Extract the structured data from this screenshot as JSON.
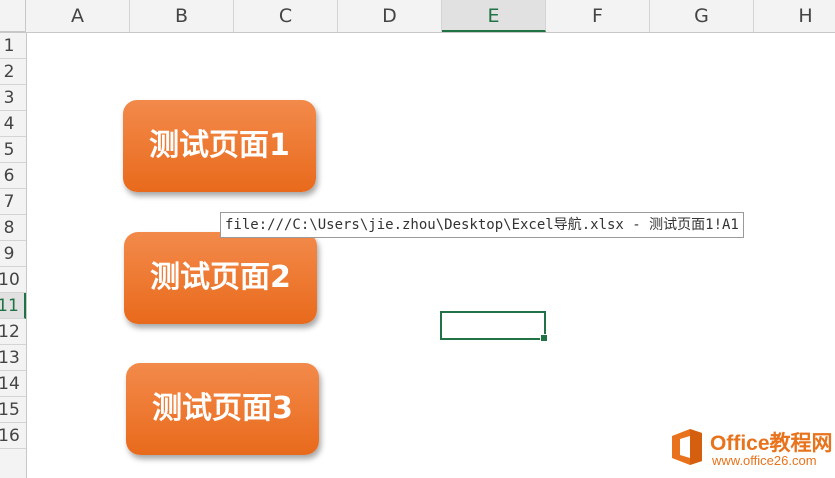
{
  "columns": [
    "A",
    "B",
    "C",
    "D",
    "E",
    "F",
    "G",
    "H"
  ],
  "active_column": "E",
  "rows": [
    "1",
    "2",
    "3",
    "4",
    "5",
    "6",
    "7",
    "8",
    "9",
    "10",
    "11",
    "12",
    "13",
    "14",
    "15",
    "16"
  ],
  "active_row": "11",
  "buttons": [
    {
      "label": "测试页面1"
    },
    {
      "label": "测试页面2"
    },
    {
      "label": "测试页面3"
    }
  ],
  "tooltip": {
    "text": "file:///C:\\Users\\jie.zhou\\Desktop\\Excel导航.xlsx - 测试页面1!A1"
  },
  "watermark": {
    "title": "Office教程网",
    "url": "www.office26.com"
  },
  "colors": {
    "accent": "#217346",
    "button": "#ee7a33",
    "brand": "#e8731c"
  }
}
